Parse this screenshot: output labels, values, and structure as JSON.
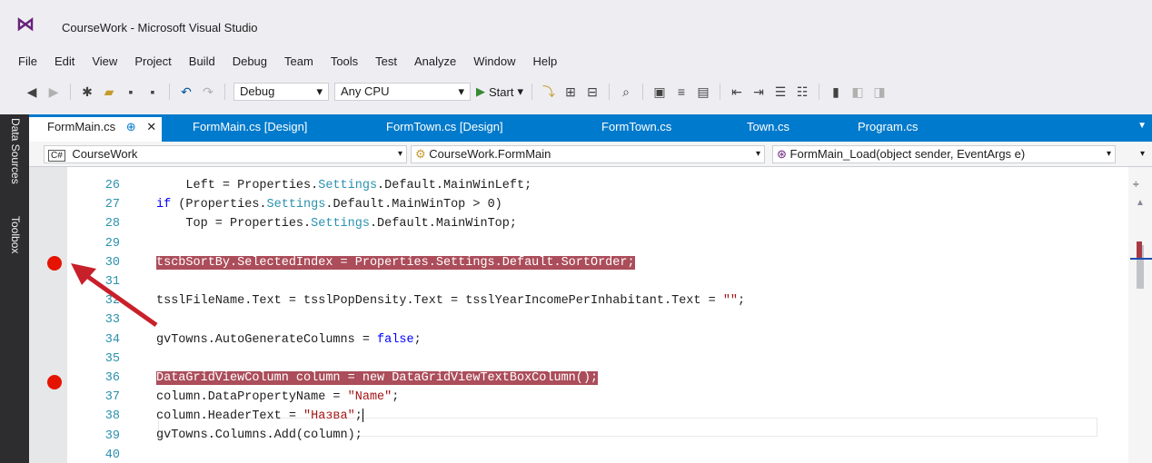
{
  "window": {
    "title": "CourseWork - Microsoft Visual Studio"
  },
  "menu": [
    "File",
    "Edit",
    "View",
    "Project",
    "Build",
    "Debug",
    "Team",
    "Tools",
    "Test",
    "Analyze",
    "Window",
    "Help"
  ],
  "toolbar": {
    "config": "Debug",
    "platform": "Any CPU",
    "start_label": "Start"
  },
  "side_tabs": [
    "Data Sources",
    "Toolbox"
  ],
  "doc_tabs": [
    "FormMain.cs",
    "FormMain.cs [Design]",
    "FormTown.cs [Design]",
    "FormTown.cs",
    "Town.cs",
    "Program.cs"
  ],
  "navbar": {
    "project": "CourseWork",
    "class": "CourseWork.FormMain",
    "member": "FormMain_Load(object sender, EventArgs e)",
    "project_badge": "C#"
  },
  "editor": {
    "line_numbers": [
      "26",
      "27",
      "28",
      "29",
      "30",
      "31",
      "32",
      "33",
      "34",
      "35",
      "36",
      "37",
      "38",
      "39",
      "40"
    ],
    "lines": [
      {
        "t": [
          {
            "s": "    Left = Properties."
          },
          {
            "s": "Settings",
            "c": "tp"
          },
          {
            "s": ".Default.MainWinLeft;"
          }
        ]
      },
      {
        "t": [
          {
            "s": "if",
            "c": "kw"
          },
          {
            "s": " (Properties."
          },
          {
            "s": "Settings",
            "c": "tp"
          },
          {
            "s": ".Default.MainWinTop > 0)"
          }
        ]
      },
      {
        "t": [
          {
            "s": "    Top = Properties."
          },
          {
            "s": "Settings",
            "c": "tp"
          },
          {
            "s": ".Default.MainWinTop;"
          }
        ]
      },
      {
        "t": []
      },
      {
        "bp": true,
        "t": [
          {
            "s": "tscbSortBy.SelectedIndex = Properties.Settings.Default.SortOrder;"
          }
        ]
      },
      {
        "t": []
      },
      {
        "t": [
          {
            "s": "tsslFileName.Text = tsslPopDensity.Text = tsslYearIncomePerInhabitant.Text = "
          },
          {
            "s": "\"\"",
            "c": "str"
          },
          {
            "s": ";"
          }
        ]
      },
      {
        "t": []
      },
      {
        "t": [
          {
            "s": "gvTowns.AutoGenerateColumns = "
          },
          {
            "s": "false",
            "c": "kw"
          },
          {
            "s": ";"
          }
        ]
      },
      {
        "t": []
      },
      {
        "bp": true,
        "t": [
          {
            "s": "DataGridViewColumn column = new DataGridViewTextBoxColumn();"
          }
        ]
      },
      {
        "t": [
          {
            "s": "column.DataPropertyName = "
          },
          {
            "s": "\"Name\"",
            "c": "str"
          },
          {
            "s": ";"
          }
        ]
      },
      {
        "t": [
          {
            "s": "column.HeaderText = "
          },
          {
            "s": "\"Назва\"",
            "c": "str"
          },
          {
            "s": ";"
          }
        ],
        "caret": true
      },
      {
        "t": [
          {
            "s": "gvTowns.Columns.Add(column);"
          }
        ]
      },
      {
        "t": []
      }
    ]
  },
  "colors": {
    "accent": "#007acc",
    "breakpoint": "#e51400",
    "breakpoint_line": "#ab4d5a",
    "arrow": "#c8202a"
  }
}
